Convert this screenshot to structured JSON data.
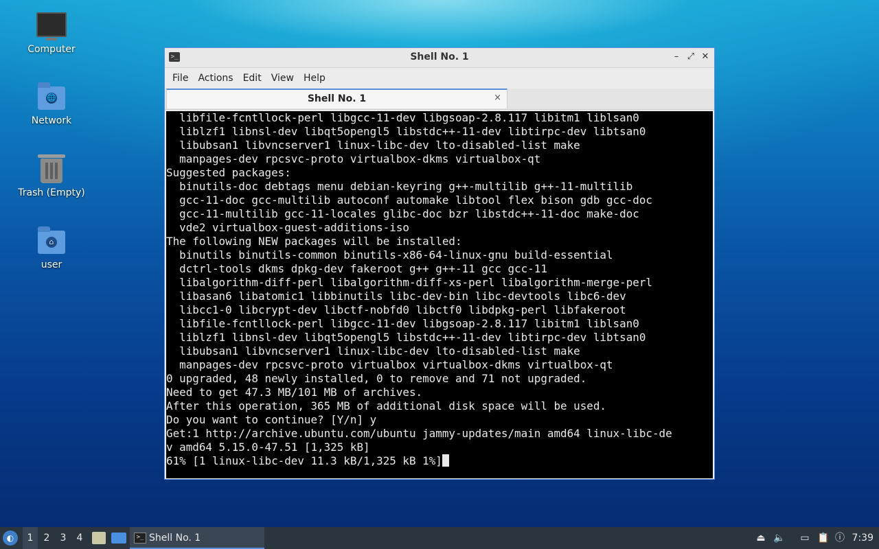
{
  "desktop": {
    "icons": [
      {
        "label": "Computer"
      },
      {
        "label": "Network"
      },
      {
        "label": "Trash (Empty)"
      },
      {
        "label": "user"
      }
    ]
  },
  "window": {
    "title": "Shell No. 1",
    "controls": {
      "minimize": "–",
      "maximize": "⤢",
      "close": "✕"
    },
    "menu": [
      "File",
      "Actions",
      "Edit",
      "View",
      "Help"
    ],
    "tab": {
      "label": "Shell No. 1",
      "close": "×"
    },
    "terminal_lines": [
      "  libfile-fcntllock-perl libgcc-11-dev libgsoap-2.8.117 libitm1 liblsan0",
      "  liblzf1 libnsl-dev libqt5opengl5 libstdc++-11-dev libtirpc-dev libtsan0",
      "  libubsan1 libvncserver1 linux-libc-dev lto-disabled-list make",
      "  manpages-dev rpcsvc-proto virtualbox-dkms virtualbox-qt",
      "Suggested packages:",
      "  binutils-doc debtags menu debian-keyring g++-multilib g++-11-multilib",
      "  gcc-11-doc gcc-multilib autoconf automake libtool flex bison gdb gcc-doc",
      "  gcc-11-multilib gcc-11-locales glibc-doc bzr libstdc++-11-doc make-doc",
      "  vde2 virtualbox-guest-additions-iso",
      "The following NEW packages will be installed:",
      "  binutils binutils-common binutils-x86-64-linux-gnu build-essential",
      "  dctrl-tools dkms dpkg-dev fakeroot g++ g++-11 gcc gcc-11",
      "  libalgorithm-diff-perl libalgorithm-diff-xs-perl libalgorithm-merge-perl",
      "  libasan6 libatomic1 libbinutils libc-dev-bin libc-devtools libc6-dev",
      "  libcc1-0 libcrypt-dev libctf-nobfd0 libctf0 libdpkg-perl libfakeroot",
      "  libfile-fcntllock-perl libgcc-11-dev libgsoap-2.8.117 libitm1 liblsan0",
      "  liblzf1 libnsl-dev libqt5opengl5 libstdc++-11-dev libtirpc-dev libtsan0",
      "  libubsan1 libvncserver1 linux-libc-dev lto-disabled-list make",
      "  manpages-dev rpcsvc-proto virtualbox virtualbox-dkms virtualbox-qt",
      "0 upgraded, 48 newly installed, 0 to remove and 71 not upgraded.",
      "Need to get 47.3 MB/101 MB of archives.",
      "After this operation, 365 MB of additional disk space will be used.",
      "Do you want to continue? [Y/n] y",
      "Get:1 http://archive.ubuntu.com/ubuntu jammy-updates/main amd64 linux-libc-de",
      "v amd64 5.15.0-47.51 [1,325 kB]",
      "61% [1 linux-libc-dev 11.3 kB/1,325 kB 1%]"
    ]
  },
  "taskbar": {
    "workspaces": [
      "1",
      "2",
      "3",
      "4"
    ],
    "task_label": "Shell No. 1",
    "clock": "7:39"
  },
  "colors": {
    "accent": "#5a8fd8",
    "terminal_bg": "#000000",
    "terminal_fg": "#e9e9e9",
    "taskbar_bg": "#2b3540"
  }
}
